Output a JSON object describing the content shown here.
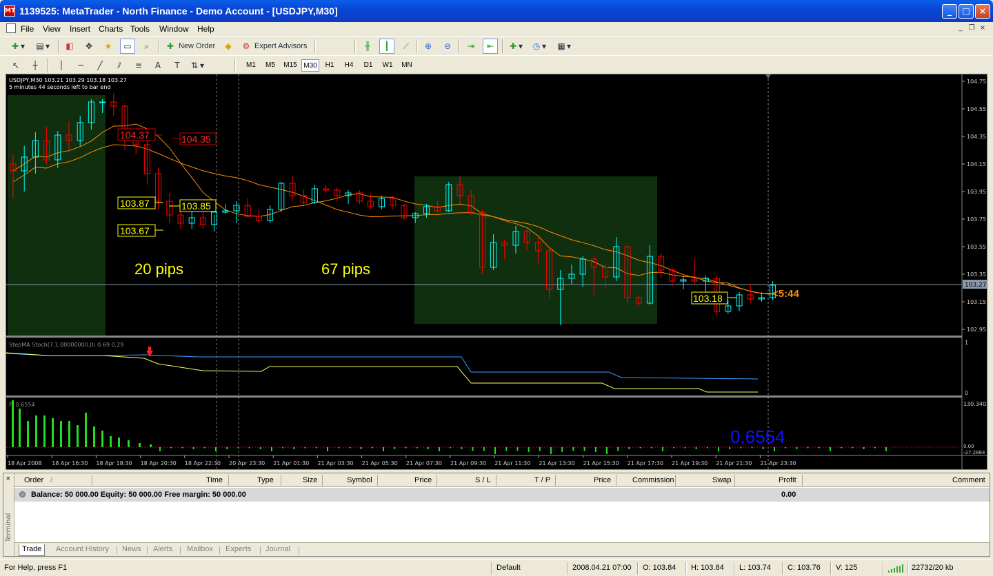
{
  "window": {
    "title": "1139525: MetaTrader - North Finance - Demo Account - [USDJPY,M30]",
    "app_icon_text": "MT"
  },
  "menu": [
    "File",
    "View",
    "Insert",
    "Charts",
    "Tools",
    "Window",
    "Help"
  ],
  "toolbar": {
    "new_order": "New Order",
    "expert_advisors": "Expert Advisors",
    "timeframes": [
      "M1",
      "M5",
      "M15",
      "M30",
      "H1",
      "H4",
      "D1",
      "W1",
      "MN"
    ],
    "active_timeframe": "M30"
  },
  "chart": {
    "symbol_line": "USDJPY,M30  103.21 103.29 103.18 103.27",
    "timer_line": "5 minutes 44 seconds left to bar end",
    "price_ticks": [
      "104.75",
      "104.55",
      "104.35",
      "104.15",
      "103.95",
      "103.75",
      "103.55",
      "103.35",
      "103.15",
      "102.95"
    ],
    "current_price": "103.27",
    "labels": {
      "high_left": "104.37",
      "high_right": "104.35",
      "mid_left": "103.87",
      "mid_right": "103.85",
      "low_left": "103.67",
      "last": "103.18",
      "pips_a": "20 pips",
      "pips_b": "67 pips",
      "countdown": "<5:44"
    },
    "colors": {
      "bull": "#00ffff",
      "bear": "#ff0000",
      "ma": "#ff8c00",
      "box": "#0f2f0f",
      "label_yellow": "#ffff00"
    },
    "candles": [
      [
        104.15,
        104.22,
        103.9,
        104.1
      ],
      [
        104.1,
        104.28,
        103.95,
        104.2
      ],
      [
        104.2,
        104.38,
        104.08,
        104.32
      ],
      [
        104.32,
        104.42,
        104.15,
        104.18
      ],
      [
        104.18,
        104.39,
        104.12,
        104.36
      ],
      [
        104.36,
        104.46,
        104.25,
        104.32
      ],
      [
        104.32,
        104.5,
        104.28,
        104.45
      ],
      [
        104.45,
        104.62,
        104.4,
        104.6
      ],
      [
        104.6,
        104.62,
        104.52,
        104.6
      ],
      [
        104.6,
        104.66,
        104.5,
        104.57
      ],
      [
        104.57,
        104.58,
        104.25,
        104.33
      ],
      [
        104.33,
        104.38,
        104.22,
        104.29
      ],
      [
        104.29,
        104.32,
        104.0,
        104.08
      ],
      [
        104.08,
        104.12,
        103.82,
        103.88
      ],
      [
        103.88,
        103.94,
        103.72,
        103.78
      ],
      [
        103.78,
        103.86,
        103.68,
        103.72
      ],
      [
        103.72,
        103.82,
        103.68,
        103.76
      ],
      [
        103.76,
        103.8,
        103.68,
        103.71
      ],
      [
        103.71,
        103.78,
        103.66,
        103.8
      ],
      [
        103.8,
        103.86,
        103.79,
        103.81
      ],
      [
        103.81,
        103.88,
        103.72,
        103.85
      ],
      [
        103.85,
        103.9,
        103.76,
        103.77
      ],
      [
        103.77,
        103.82,
        103.72,
        103.74
      ],
      [
        103.74,
        103.85,
        103.72,
        103.82
      ],
      [
        103.82,
        104.02,
        103.8,
        104.01
      ],
      [
        104.01,
        104.06,
        103.88,
        103.92
      ],
      [
        103.92,
        103.97,
        103.84,
        103.87
      ],
      [
        103.87,
        104.0,
        103.86,
        103.97
      ],
      [
        103.97,
        104.0,
        103.94,
        103.96
      ],
      [
        103.96,
        103.98,
        103.88,
        103.92
      ],
      [
        103.92,
        103.96,
        103.86,
        103.94
      ],
      [
        103.94,
        103.96,
        103.86,
        103.88
      ],
      [
        103.88,
        103.93,
        103.82,
        103.84
      ],
      [
        103.84,
        103.92,
        103.82,
        103.9
      ],
      [
        103.9,
        103.92,
        103.82,
        103.85
      ],
      [
        103.85,
        103.86,
        103.74,
        103.76
      ],
      [
        103.76,
        103.8,
        103.72,
        103.79
      ],
      [
        103.79,
        103.86,
        103.76,
        103.84
      ],
      [
        103.84,
        103.88,
        103.8,
        103.81
      ],
      [
        103.81,
        104.02,
        103.8,
        104.0
      ],
      [
        104.0,
        104.06,
        103.86,
        103.92
      ],
      [
        103.92,
        103.96,
        103.78,
        103.8
      ],
      [
        103.8,
        103.82,
        103.35,
        103.4
      ],
      [
        103.4,
        103.64,
        103.38,
        103.58
      ],
      [
        103.58,
        103.6,
        103.46,
        103.56
      ],
      [
        103.56,
        103.7,
        103.5,
        103.66
      ],
      [
        103.66,
        103.68,
        103.52,
        103.58
      ],
      [
        103.58,
        103.62,
        103.42,
        103.52
      ],
      [
        103.52,
        103.54,
        103.18,
        103.24
      ],
      [
        103.24,
        103.38,
        102.98,
        103.32
      ],
      [
        103.32,
        103.42,
        103.28,
        103.35
      ],
      [
        103.35,
        103.48,
        103.26,
        103.46
      ],
      [
        103.46,
        103.48,
        103.2,
        103.4
      ],
      [
        103.4,
        103.42,
        103.24,
        103.33
      ],
      [
        103.33,
        103.62,
        103.3,
        103.55
      ],
      [
        103.55,
        103.56,
        103.14,
        103.18
      ],
      [
        103.18,
        103.2,
        103.12,
        103.14
      ],
      [
        103.14,
        103.56,
        103.13,
        103.48
      ],
      [
        103.48,
        103.5,
        103.32,
        103.38
      ],
      [
        103.38,
        103.4,
        103.26,
        103.3
      ],
      [
        103.3,
        103.34,
        103.24,
        103.31
      ],
      [
        103.31,
        103.46,
        103.28,
        103.3
      ],
      [
        103.3,
        103.34,
        103.22,
        103.32
      ],
      [
        103.32,
        103.34,
        103.05,
        103.08
      ],
      [
        103.08,
        103.16,
        103.06,
        103.12
      ],
      [
        103.12,
        103.22,
        103.08,
        103.2
      ],
      [
        103.2,
        103.28,
        103.14,
        103.17
      ],
      [
        103.17,
        103.22,
        103.15,
        103.18
      ],
      [
        103.18,
        103.3,
        103.16,
        103.27
      ]
    ]
  },
  "stoch": {
    "label": "StepMA Stoch(7,1.00000000,0) 0.69 0.29",
    "ticks": [
      "1",
      "0"
    ]
  },
  "fi": {
    "label": "FI 0.6554",
    "ticks": [
      "130.3402",
      "0.00",
      "-27.2864"
    ],
    "value_big": "0.6554"
  },
  "time_axis": [
    "18 Apr 2008",
    "18 Apr 16:30",
    "18 Apr 18:30",
    "18 Apr 20:30",
    "18 Apr 22:30",
    "20 Apr 23:30",
    "21 Apr 01:30",
    "21 Apr 03:30",
    "21 Apr 05:30",
    "21 Apr 07:30",
    "21 Apr 09:30",
    "21 Apr 11:30",
    "21 Apr 13:30",
    "21 Apr 15:30",
    "21 Apr 17:30",
    "21 Apr 19:30",
    "21 Apr 21:30",
    "21 Apr 23:30"
  ],
  "terminal": {
    "side_label": "Terminal",
    "columns": [
      "Order",
      "/",
      "Time",
      "Type",
      "Size",
      "Symbol",
      "Price",
      "S / L",
      "T / P",
      "Price",
      "Commission",
      "Swap",
      "Profit",
      "Comment"
    ],
    "balance_text": "Balance: 50 000.00  Equity: 50 000.00  Free margin: 50 000.00",
    "profit": "0.00",
    "tabs": [
      "Trade",
      "Account History",
      "News",
      "Alerts",
      "Mailbox",
      "Experts",
      "Journal"
    ],
    "active_tab": "Trade"
  },
  "status": {
    "help": "For Help, press F1",
    "profile": "Default",
    "datetime": "2008.04.21 07:00",
    "open": "O: 103.84",
    "high": "H: 103.84",
    "low": "L: 103.74",
    "close": "C: 103.76",
    "volume": "V: 125",
    "traffic": "22732/20 kb"
  }
}
